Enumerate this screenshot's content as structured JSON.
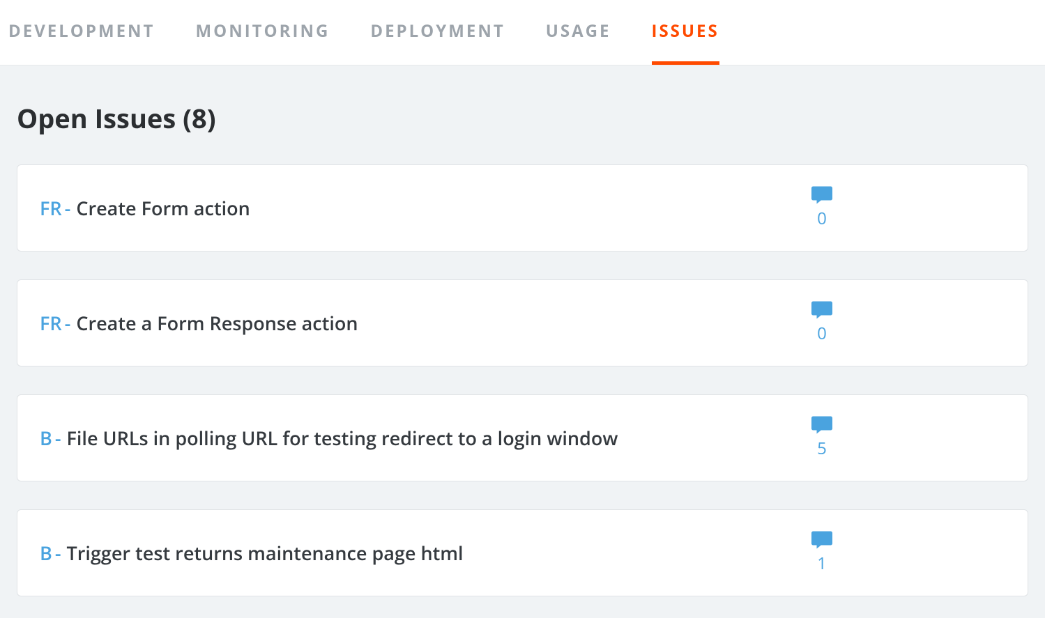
{
  "tabs": [
    {
      "label": "DEVELOPMENT",
      "name": "tab-development",
      "active": false
    },
    {
      "label": "MONITORING",
      "name": "tab-monitoring",
      "active": false
    },
    {
      "label": "DEPLOYMENT",
      "name": "tab-deployment",
      "active": false
    },
    {
      "label": "USAGE",
      "name": "tab-usage",
      "active": false
    },
    {
      "label": "ISSUES",
      "name": "tab-issues",
      "active": true
    }
  ],
  "page_title": "Open Issues (8)",
  "issues": [
    {
      "tag": "FR",
      "title": "Create Form action",
      "comments": 0
    },
    {
      "tag": "FR",
      "title": "Create a Form Response action",
      "comments": 0
    },
    {
      "tag": "B",
      "title": "File URLs in polling URL for testing redirect to a login window",
      "comments": 5
    },
    {
      "tag": "B",
      "title": "Trigger test returns maintenance page html",
      "comments": 1
    }
  ],
  "colors": {
    "accent": "#ff4a00",
    "link": "#4aa3df",
    "background": "#f0f3f5"
  }
}
